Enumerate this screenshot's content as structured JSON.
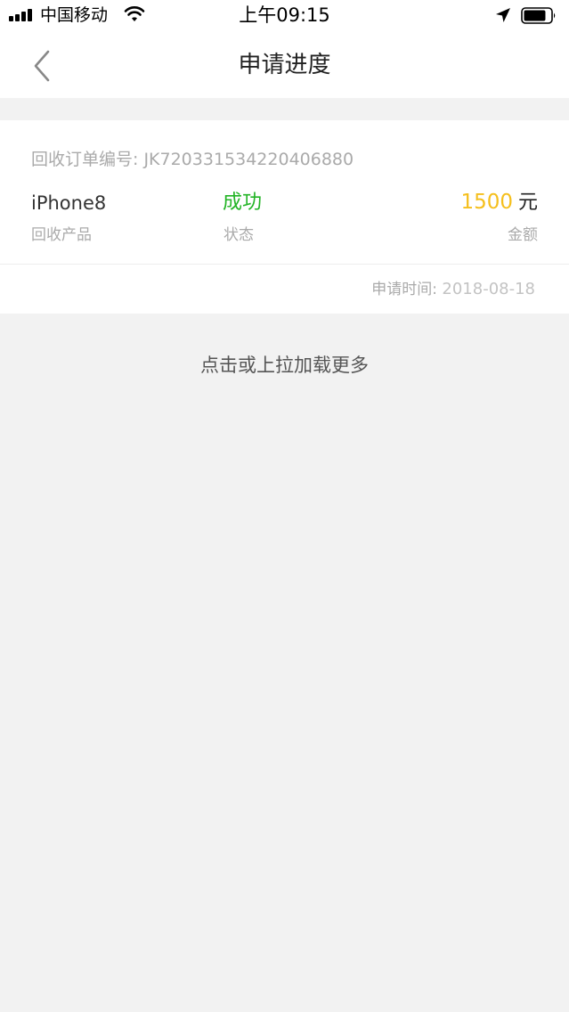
{
  "status_bar": {
    "carrier": "中国移动",
    "time": "上午09:15",
    "icons": [
      "signal-icon",
      "wifi-icon",
      "location-arrow-icon",
      "battery-icon"
    ]
  },
  "nav": {
    "title": "申请进度",
    "back_icon": "chevron-left-icon"
  },
  "order": {
    "order_number_text": "回收订单编号: JK72033153422040688​0",
    "product": "iPhone8",
    "product_label": "回收产品",
    "status": "成功",
    "status_label": "状态",
    "amount": "1500",
    "amount_unit": "元",
    "amount_label": "金额",
    "apply_time_label": "申请时间: ",
    "apply_time_value": "2018-08-18"
  },
  "load_more": "点击或上拉加载更多",
  "colors": {
    "background": "#f2f2f2",
    "card": "#ffffff",
    "status_success": "#22b425",
    "amount": "#f5bf1c",
    "secondary_text": "#aaaaaa"
  }
}
